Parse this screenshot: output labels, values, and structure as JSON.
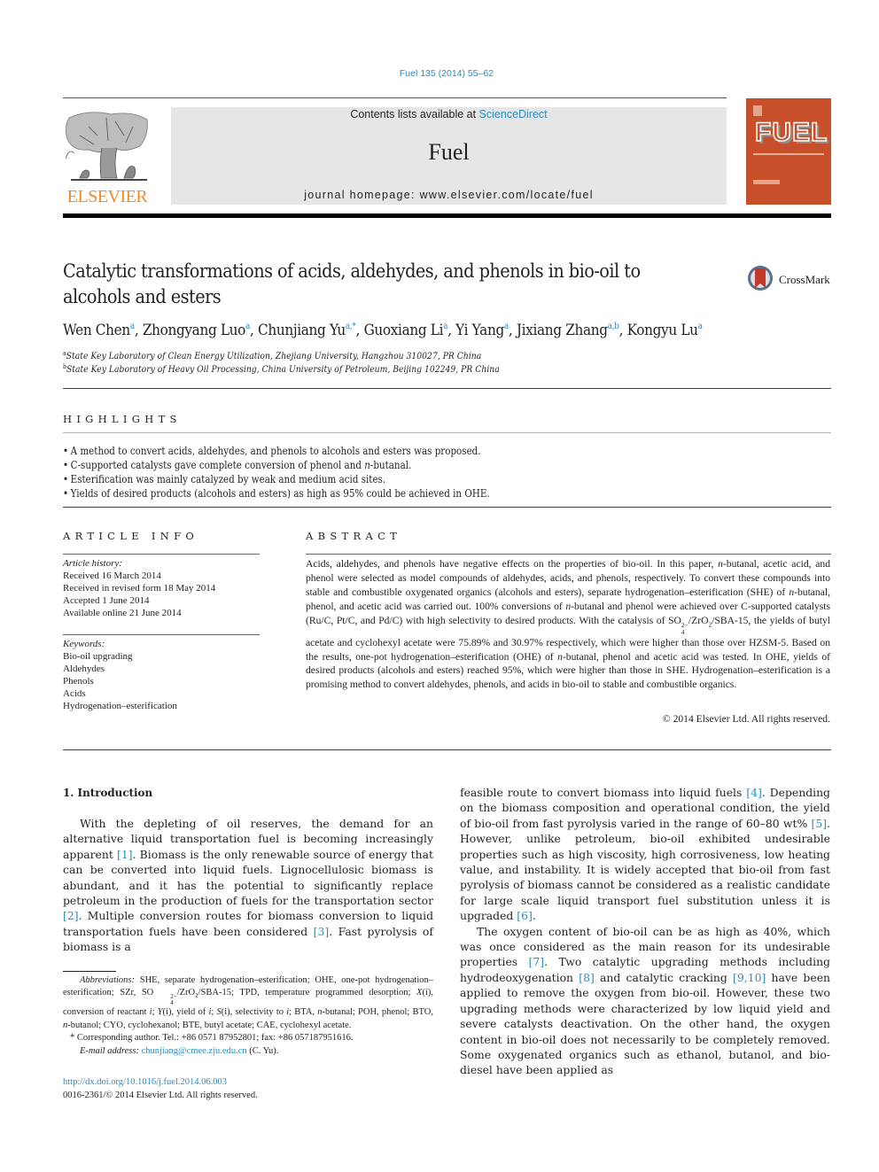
{
  "header": {
    "journal_ref": "Fuel 135 (2014) 55–62",
    "contents_prefix": "Contents lists available at ",
    "contents_link": "ScienceDirect",
    "journal_name": "Fuel",
    "homepage": "journal homepage: www.elsevier.com/locate/fuel",
    "publisher_logo_text": "ELSEVIER",
    "cover_title": "FUEL",
    "crossmark_label": "CrossMark",
    "colors": {
      "link": "#2a8dbd",
      "elsevier_orange": "#f08a23",
      "cover_orange": "#c7502a",
      "masthead_gray": "#e6e6e6"
    }
  },
  "article": {
    "title": "Catalytic transformations of acids, aldehydes, and phenols in bio-oil to alcohols and esters",
    "authors": [
      {
        "name": "Wen Chen",
        "sup": "a"
      },
      {
        "name": "Zhongyang Luo",
        "sup": "a"
      },
      {
        "name": "Chunjiang Yu",
        "sup": "a,*"
      },
      {
        "name": "Guoxiang Li",
        "sup": "a"
      },
      {
        "name": "Yi Yang",
        "sup": "a"
      },
      {
        "name": "Jixiang Zhang",
        "sup": "a,b"
      },
      {
        "name": "Kongyu Lu",
        "sup": "a"
      }
    ],
    "affiliations": [
      {
        "mark": "a",
        "text": "State Key Laboratory of Clean Energy Utilization, Zhejiang University, Hangzhou 310027, PR China"
      },
      {
        "mark": "b",
        "text": "State Key Laboratory of Heavy Oil Processing, China University of Petroleum, Beijing 102249, PR China"
      }
    ]
  },
  "highlights": {
    "heading": "HIGHLIGHTS",
    "items": [
      "A method to convert acids, aldehydes, and phenols to alcohols and esters was proposed.",
      "C-supported catalysts gave complete conversion of phenol and n-butanal.",
      "Esterification was mainly catalyzed by weak and medium acid sites.",
      "Yields of desired products (alcohols and esters) as high as 95% could be achieved in OHE."
    ]
  },
  "article_info": {
    "heading": "ARTICLE INFO",
    "history_label": "Article history:",
    "history": [
      "Received 16 March 2014",
      "Received in revised form 18 May 2014",
      "Accepted 1 June 2014",
      "Available online 21 June 2014"
    ],
    "keywords_label": "Keywords:",
    "keywords": [
      "Bio-oil upgrading",
      "Aldehydes",
      "Phenols",
      "Acids",
      "Hydrogenation–esterification"
    ]
  },
  "abstract": {
    "heading": "ABSTRACT",
    "p1": "Acids, aldehydes, and phenols have negative effects on the properties of bio-oil. In this paper, ",
    "p2": "-butanal, acetic acid, and phenol were selected as model compounds of aldehydes, acids, and phenols, respectively. To convert these compounds into stable and combustible oxygenated organics (alcohols and esters), separate hydrogenation–esterification (SHE) of ",
    "p3": "-butanal, phenol, and acetic acid was carried out. 100% conversions of ",
    "p4": "-butanal and phenol were achieved over C-supported catalysts (Ru/C, Pt/C, and Pd/C) with high selectivity to desired products. With the catalysis of SO",
    "p5": "/ZrO",
    "p6": "/SBA-15, the yields of butyl acetate and cyclohexyl acetate were 75.89% and 30.97% respectively, which were higher than those over HZSM-5. Based on the results, one-pot hydrogenation–esterification (OHE) of ",
    "p7": "-butanal, phenol and acetic acid was tested. In OHE, yields of desired products (alcohols and esters) reached 95%, which were higher than those in SHE. Hydrogenation–esterification is a promising method to convert aldehydes, phenols, and acids in bio-oil to stable and combustible organics.",
    "n": "n",
    "sub4": "4",
    "sup2minus": "2−",
    "sub2": "2",
    "copyright": "© 2014 Elsevier Ltd. All rights reserved."
  },
  "introduction": {
    "heading": "1. Introduction",
    "left": {
      "t1": "With the depleting of oil reserves, the demand for an alternative liquid transportation fuel is becoming increasingly apparent ",
      "r1": "[1]",
      "t2": ". Biomass is the only renewable source of energy that can be converted into liquid fuels. Lignocellulosic biomass is abundant, and it has the potential to significantly replace petroleum in the production of fuels for the transportation sector ",
      "r2": "[2]",
      "t3": ". Multiple conversion routes for biomass conversion to liquid transportation fuels have been considered ",
      "r3": "[3]",
      "t4": ". Fast pyrolysis of biomass is a"
    },
    "right1": {
      "t1": "feasible route to convert biomass into liquid fuels ",
      "r4": "[4]",
      "t2": ". Depending on the biomass composition and operational condition, the yield of bio-oil from fast pyrolysis varied in the range of 60–80 wt% ",
      "r5": "[5]",
      "t3": ". However, unlike petroleum, bio-oil exhibited undesirable properties such as high viscosity, high corrosiveness, low heating value, and instability. It is widely accepted that bio-oil from fast pyrolysis of biomass cannot be considered as a realistic candidate for large scale liquid transport fuel substitution unless it is upgraded ",
      "r6": "[6]",
      "t4": "."
    },
    "right2": {
      "t1": "The oxygen content of bio-oil can be as high as 40%, which was once considered as the main reason for its undesirable properties ",
      "r7": "[7]",
      "t2": ". Two catalytic upgrading methods including hydrodeoxygenation ",
      "r8": "[8]",
      "t3": " and catalytic cracking ",
      "r9": "[9,10]",
      "t4": " have been applied to remove the oxygen from bio-oil. However, these two upgrading methods were characterized by low liquid yield and severe catalysts deactivation. On the other hand, the oxygen content in bio-oil does not necessarily to be completely removed. Some oxygenated organics such as ethanol, butanol, and bio-diesel have been applied as"
    }
  },
  "footnotes": {
    "abbrev_label": "Abbreviations:",
    "abbrev_a": " SHE, separate hydrogenation–esterification; OHE, one-pot hydrogenation–esterification; SZr, SO",
    "abbrev_b": "/ZrO",
    "abbrev_c": "/SBA-15; TPD, temperature programmed desorption; ",
    "x": "X",
    "abbrev_d": "(i), conversion of reactant ",
    "i": "i",
    "abbrev_e": "; ",
    "y": "Y",
    "abbrev_f": "(i), yield of ",
    "s": "S",
    "abbrev_g": "(i), selectivity to ",
    "abbrev_h": "; BTA, ",
    "abbrev_i": "-butanal; POH, phenol; BTO, ",
    "abbrev_j": "-butanol; CYO, cyclohexanol; BTE, butyl acetate; CAE, cyclohexyl acetate.",
    "corresponding": "* Corresponding author. Tel.: +86 0571 87952801; fax: +86 057187951616.",
    "email_label": "E-mail address:",
    "email": "chunjiang@cmee.zju.edu.cn",
    "email_suffix": " (C. Yu).",
    "doi": "http://dx.doi.org/10.1016/j.fuel.2014.06.003",
    "issn": "0016-2361/© 2014 Elsevier Ltd. All rights reserved."
  }
}
